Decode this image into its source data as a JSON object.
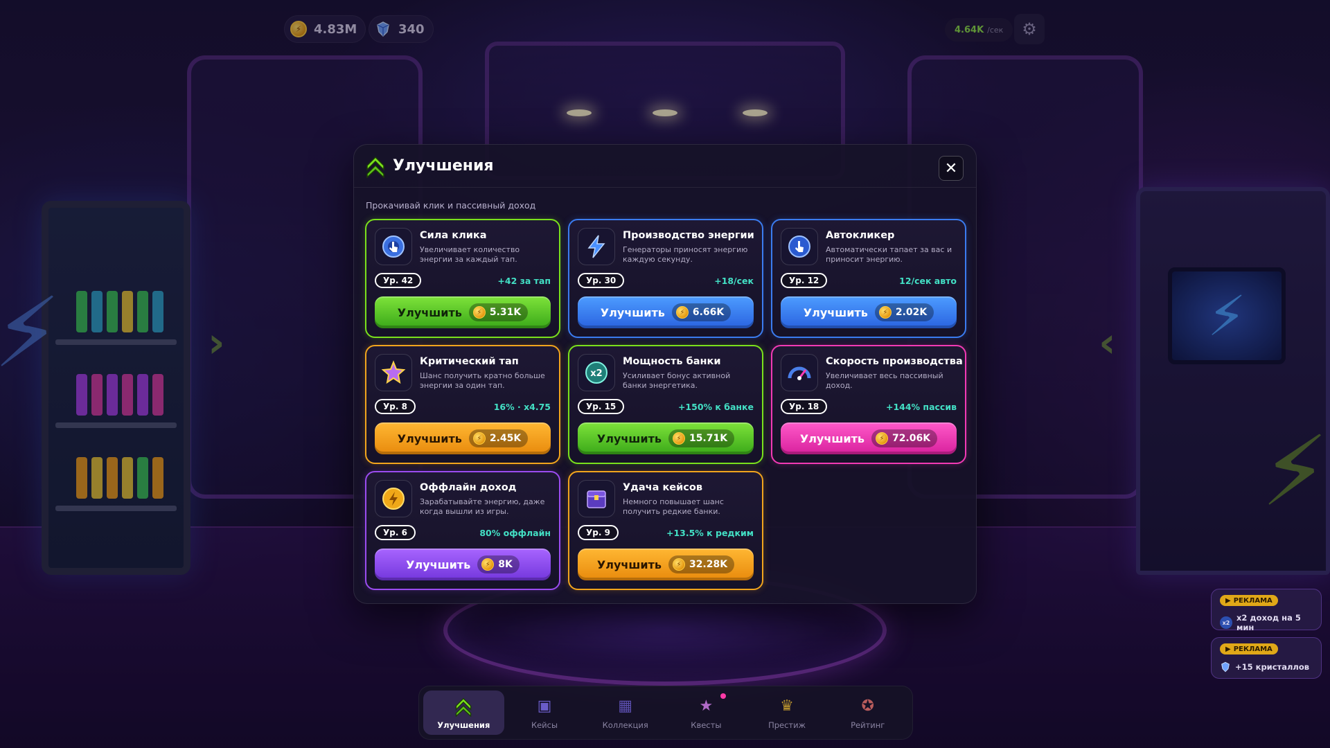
{
  "top": {
    "coins": "4.83M",
    "gems": "340",
    "rate_value": "4.64K",
    "rate_unit": "/сек"
  },
  "modal": {
    "title": "Улучшения",
    "subtitle": "Прокачивай клик и пассивный доход",
    "cards": [
      {
        "title": "Сила клика",
        "desc": "Увеличивает количество энергии за каждый тап.",
        "level": "Ур. 42",
        "effect": "+42 за тап",
        "button": "Улучшить",
        "price": "5.31K",
        "color": "green",
        "icon": "tap-hand-icon"
      },
      {
        "title": "Производство энергии",
        "desc": "Генераторы приносят энергию каждую секунду.",
        "level": "Ур. 30",
        "effect": "+18/сек",
        "button": "Улучшить",
        "price": "6.66K",
        "color": "blue",
        "icon": "lightning-icon"
      },
      {
        "title": "Автокликер",
        "desc": "Автоматически тапает за вас и приносит энергию.",
        "level": "Ур. 12",
        "effect": "12/сек авто",
        "button": "Улучшить",
        "price": "2.02K",
        "color": "blue",
        "icon": "auto-tap-icon"
      },
      {
        "title": "Критический тап",
        "desc": "Шанс получить кратно больше энергии за один тап.",
        "level": "Ур. 8",
        "effect": "16% · x4.75",
        "button": "Улучшить",
        "price": "2.45K",
        "color": "orange",
        "icon": "star-icon"
      },
      {
        "title": "Мощность банки",
        "desc": "Усиливает бонус активной банки энергетика.",
        "level": "Ур. 15",
        "effect": "+150% к банке",
        "button": "Улучшить",
        "price": "15.71K",
        "color": "green",
        "icon": "x2-icon"
      },
      {
        "title": "Скорость производства",
        "desc": "Увеличивает весь пассивный доход.",
        "level": "Ур. 18",
        "effect": "+144% пассив",
        "button": "Улучшить",
        "price": "72.06K",
        "color": "pink",
        "icon": "speedometer-icon"
      },
      {
        "title": "Оффлайн доход",
        "desc": "Зарабатывайте энергию, даже когда вышли из игры.",
        "level": "Ур. 6",
        "effect": "80% оффлайн",
        "button": "Улучшить",
        "price": "8K",
        "color": "purple",
        "icon": "coin-icon"
      },
      {
        "title": "Удача кейсов",
        "desc": "Немного повышает шанс получить редкие банки.",
        "level": "Ур. 9",
        "effect": "+13.5% к редким",
        "button": "Улучшить",
        "price": "32.28K",
        "color": "orange",
        "icon": "chest-icon"
      }
    ]
  },
  "ads": [
    {
      "tag": "РЕКЛАМА",
      "text": "x2 доход на 5 мин"
    },
    {
      "tag": "РЕКЛАМА",
      "text": "+15 кристаллов"
    }
  ],
  "nav": [
    {
      "label": "Улучшения",
      "icon": "upgrade-chevrons-icon",
      "active": true
    },
    {
      "label": "Кейсы",
      "icon": "case-icon"
    },
    {
      "label": "Коллекция",
      "icon": "collection-icon"
    },
    {
      "label": "Квесты",
      "icon": "quest-star-icon"
    },
    {
      "label": "Престиж",
      "icon": "crown-icon"
    },
    {
      "label": "Рейтинг",
      "icon": "rating-medal-icon"
    }
  ]
}
